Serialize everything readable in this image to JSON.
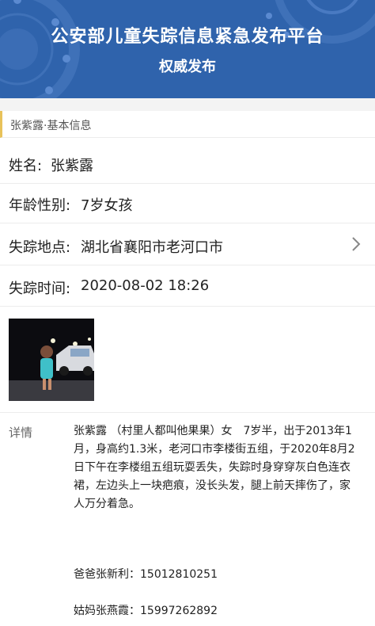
{
  "header": {
    "title": "公安部儿童失踪信息紧急发布平台",
    "subtitle": "权威发布",
    "background_color": "#2f63ac"
  },
  "section": {
    "title": "张紫露·基本信息",
    "accent_color": "#e8c25a"
  },
  "fields": [
    {
      "label": "姓名:",
      "value": "张紫露"
    },
    {
      "label": "年龄性别:",
      "value": "7岁女孩"
    },
    {
      "label": "失踪地点:",
      "value": "湖北省襄阳市老河口市",
      "icon": "chevron-right-icon"
    },
    {
      "label": "失踪时间:",
      "value": "2020-08-02 18:26"
    }
  ],
  "details": {
    "label": "详情",
    "text": "张紫露 （村里人都叫他果果）女　7岁半，出于2013年1月，身高约1.3米，老河口市李楼街五组，于2020年8月2日下午在李楼组五组玩耍丢失，失踪时身穿穿灰白色连衣裙，左边头上一块疤痕，没长头发，腿上前天摔伤了，家人万分着急。",
    "contacts": [
      "爸爸张新利：15012810251",
      "姑妈张燕霞：15997262892"
    ]
  }
}
